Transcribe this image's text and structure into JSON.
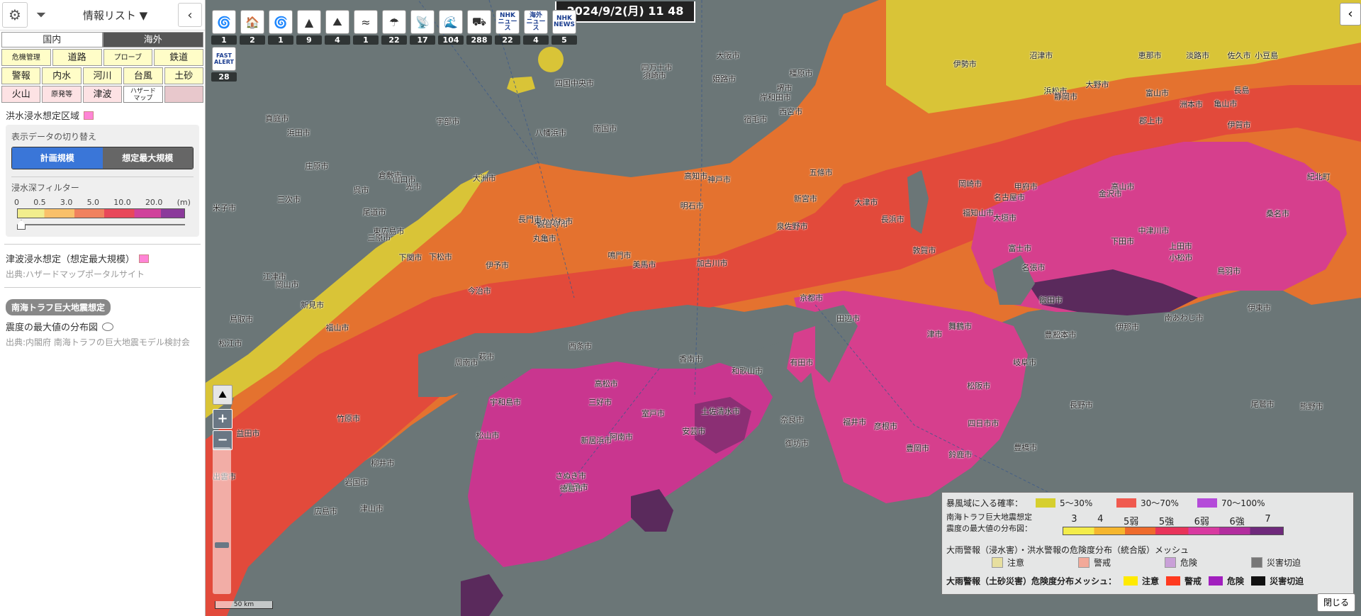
{
  "sidebar": {
    "title": "情報リスト ▼",
    "collapse_icon": "‹",
    "region_tabs": [
      "国内",
      "海外"
    ],
    "categories": [
      [
        "危機管理",
        "道路",
        "プローブ",
        "鉄道"
      ],
      [
        "警報",
        "内水",
        "河川",
        "台風",
        "土砂"
      ],
      [
        "火山",
        "原発等",
        "津波",
        "ハザード\nマップ",
        ""
      ]
    ],
    "flood_title": "洪水浸水想定区域",
    "display_switch_label": "表示データの切り替え",
    "toggle": [
      "計画規模",
      "想定最大規模"
    ],
    "depth_filter_label": "浸水深フィルター",
    "depth_ticks": [
      "0",
      "0.5",
      "3.0",
      "5.0",
      "10.0",
      "20.0",
      "(m)"
    ],
    "tsunami_title": "津波浸水想定（想定最大規模）",
    "tsunami_source": "出典:ハザードマップポータルサイト",
    "nankai_badge": "南海トラフ巨大地震想定",
    "intensity_title": "震度の最大値の分布図",
    "intensity_source": "出典:内閣府 南海トラフの巨大地震モデル検討会"
  },
  "toolbar": {
    "datetime": "2024/9/2(月)  11 48",
    "items": [
      {
        "icon": "typhoon-icon",
        "glyph": "🌀",
        "count": "1"
      },
      {
        "icon": "flood-house-icon",
        "glyph": "🏠",
        "count": "2"
      },
      {
        "icon": "typhoon-icon",
        "glyph": "🌀",
        "count": "1"
      },
      {
        "icon": "volcano-icon",
        "glyph": "▲",
        "count": "9"
      },
      {
        "icon": "landslide-icon",
        "glyph": "⛰",
        "count": "4"
      },
      {
        "icon": "river-icon",
        "glyph": "≈",
        "count": "1"
      },
      {
        "icon": "rain-icon",
        "glyph": "☂",
        "count": "22"
      },
      {
        "icon": "antenna-icon",
        "glyph": "📡",
        "count": "17"
      },
      {
        "icon": "tsunami-icon",
        "glyph": "🌊",
        "count": "104"
      },
      {
        "icon": "road-icon",
        "glyph": "⛟",
        "count": "288"
      },
      {
        "icon": "nhk-news-icon",
        "glyph": "NHK\nニュース",
        "count": "22"
      },
      {
        "icon": "overseas-news-icon",
        "glyph": "海外\nニュース",
        "count": "4"
      },
      {
        "icon": "nhk-news-en-icon",
        "glyph": "NHK\nNEWS",
        "count": "5"
      }
    ],
    "fast_alert": {
      "label": "FAST\nALERT",
      "count": "28"
    }
  },
  "map": {
    "scale_label": "50 km",
    "zoom_in": "+",
    "zoom_out": "−",
    "cities": [
      "松江市",
      "米子市",
      "鳥取市",
      "出雲市",
      "江津市",
      "益田市",
      "浜田市",
      "三次市",
      "庄原市",
      "新見市",
      "真庭市",
      "津山市",
      "岡山市",
      "倉敷市",
      "福山市",
      "尾道市",
      "広島市",
      "呉市",
      "東広島市",
      "竹原市",
      "三原市",
      "岩国市",
      "柳井市",
      "光市",
      "下松市",
      "周南市",
      "山口市",
      "宇部市",
      "下関市",
      "萩市",
      "長門市",
      "今治市",
      "松山市",
      "伊予市",
      "大洲市",
      "八幡浜市",
      "宇和島市",
      "西予市",
      "新居浜市",
      "西条市",
      "四国中央市",
      "観音寺市",
      "丸亀市",
      "高松市",
      "さぬき市",
      "東かがわ市",
      "鳴門市",
      "徳島市",
      "阿南市",
      "美馬市",
      "三好市",
      "高知市",
      "南国市",
      "香南市",
      "安芸市",
      "室戸市",
      "須崎市",
      "四万十市",
      "土佐清水市",
      "宿毛市",
      "姫路市",
      "加古川市",
      "明石市",
      "神戸市",
      "西宮市",
      "大阪市",
      "堺市",
      "岸和田市",
      "泉佐野市",
      "和歌山市",
      "有田市",
      "御坊市",
      "田辺市",
      "新宮市",
      "奈良市",
      "橿原市",
      "五條市",
      "京都市",
      "大津市",
      "彦根市",
      "長浜市",
      "福井市",
      "敦賀市",
      "舞鶴市",
      "豊岡市",
      "福知山市",
      "津市",
      "四日市市",
      "鈴鹿市",
      "松阪市",
      "伊勢市",
      "名張市",
      "名古屋市",
      "岐阜市",
      "大垣市",
      "豊田市",
      "岡崎市",
      "豊橋市",
      "浜松市",
      "静岡市",
      "富士市",
      "沼津市",
      "下田市",
      "甲府市",
      "飯田市",
      "松本市",
      "長野市",
      "高山市",
      "富山市",
      "金沢市",
      "小松市",
      "大野市",
      "郡上市",
      "中津川市",
      "恵那市",
      "伊那市",
      "上田市",
      "佐久市",
      "洲本市",
      "淡路市",
      "南あわじ市",
      "小豆島",
      "伊賀市",
      "亀山市",
      "桑名市",
      "鳥羽市",
      "熊野市",
      "尾鷲市",
      "紀北町",
      "長島",
      "伊東市"
    ],
    "legend": {
      "storm_label": "暴風域に入る確率：",
      "storm_items": [
        {
          "label": "5〜30%",
          "color": "#d6cf2e"
        },
        {
          "label": "30〜70%",
          "color": "#f05a4f"
        },
        {
          "label": "70〜100%",
          "color": "#b44bd9"
        }
      ],
      "nankai_label_1": "南海トラフ巨大地震想定",
      "nankai_label_2": "震度の最大値の分布図：",
      "intensity_ticks": [
        "3",
        "4",
        "5弱",
        "5強",
        "6弱",
        "6強",
        "7"
      ],
      "rain_title": "大雨警報（浸水害）・洪水警報の危険度分布（統合版）メッシュ",
      "rain_items": [
        {
          "label": "注意",
          "color": "#e7df9f"
        },
        {
          "label": "警戒",
          "color": "#f2a999"
        },
        {
          "label": "危険",
          "color": "#c9a0d8"
        },
        {
          "label": "災害切迫",
          "color": "#777"
        }
      ],
      "landslide_label": "大雨警報（土砂災害）危険度分布メッシュ：",
      "landslide_items": [
        {
          "label": "注意",
          "color": "#ffea00"
        },
        {
          "label": "警戒",
          "color": "#ff3a1f"
        },
        {
          "label": "危険",
          "color": "#a11fbe"
        },
        {
          "label": "災害切迫",
          "color": "#111"
        }
      ],
      "close_label": "閉じる"
    }
  },
  "colors": {
    "sea": "#6b7677",
    "yellow": "#d9c437",
    "orange": "#e8702d",
    "red": "#e24a3b",
    "pink": "#d93f8c",
    "magenta": "#c43399",
    "dark_purple": "#5a2a5c"
  }
}
